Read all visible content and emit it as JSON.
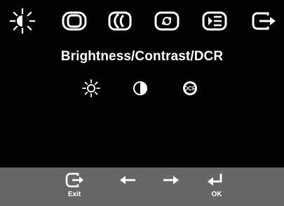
{
  "menu": {
    "title": "Brightness/Contrast/DCR",
    "tabs": [
      {
        "icon": "sun-icon",
        "selected": true
      },
      {
        "icon": "image-position-icon",
        "selected": false
      },
      {
        "icon": "image-properties-icon",
        "selected": false
      },
      {
        "icon": "options-icon",
        "selected": false
      },
      {
        "icon": "menu-icon",
        "selected": false
      },
      {
        "icon": "exit-icon",
        "selected": false
      }
    ],
    "sub_items": [
      {
        "icon": "brightness-icon"
      },
      {
        "icon": "contrast-icon"
      },
      {
        "icon": "dcr-icon"
      }
    ],
    "dcr_mark": "DCR"
  },
  "bottom_bar": {
    "exit_label": "Exit",
    "ok_label": "OK",
    "left_icon": "left-arrow-icon",
    "right_icon": "right-arrow-icon"
  },
  "colors": {
    "background": "#030303",
    "foreground": "#ffffff",
    "bottom_bar": "#666666"
  }
}
